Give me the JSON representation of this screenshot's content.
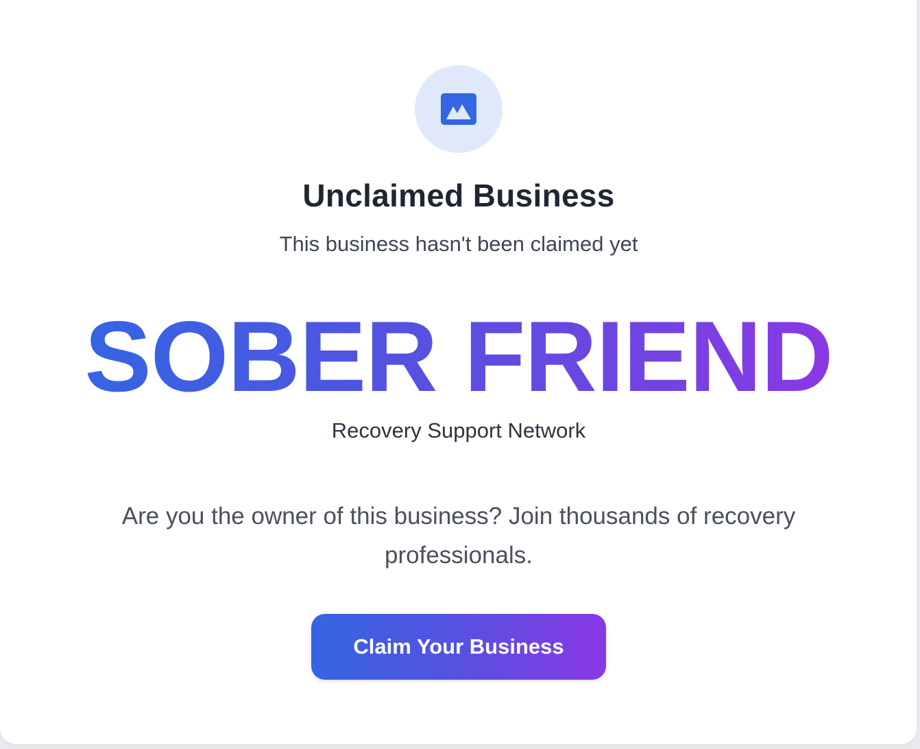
{
  "card": {
    "icon": "image-icon",
    "title": "Unclaimed Business",
    "subtitle": "This business hasn't been claimed yet",
    "brand_name": "SOBER FRIEND",
    "tagline": "Recovery Support Network",
    "pitch": "Are you the owner of this business? Join thousands of recovery professionals.",
    "claim_button_label": "Claim Your Business"
  },
  "colors": {
    "accent_start": "#3465e3",
    "accent_end": "#8a38e4",
    "icon_bg": "#dfe9fb",
    "title_text": "#1f2633"
  }
}
